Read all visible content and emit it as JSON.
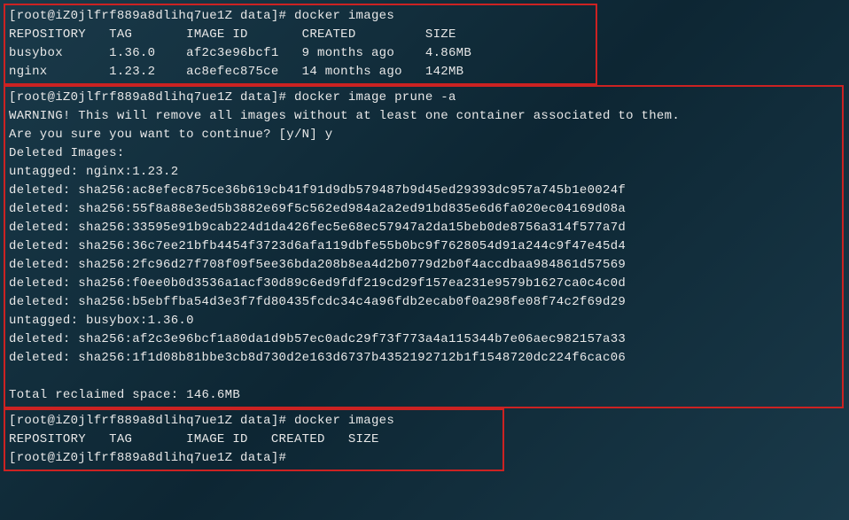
{
  "section1": {
    "prompt": "[root@iZ0jlfrf889a8dlihq7ue1Z data]# docker images",
    "header": "REPOSITORY   TAG       IMAGE ID       CREATED         SIZE",
    "row1": "busybox      1.36.0    af2c3e96bcf1   9 months ago    4.86MB",
    "row2": "nginx        1.23.2    ac8efec875ce   14 months ago   142MB"
  },
  "section2": {
    "prompt": "[root@iZ0jlfrf889a8dlihq7ue1Z data]# docker image prune -a",
    "warning": "WARNING! This will remove all images without at least one container associated to them.",
    "confirm": "Are you sure you want to continue? [y/N] y",
    "deleted_header": "Deleted Images:",
    "untagged1": "untagged: nginx:1.23.2",
    "deleted1": "deleted: sha256:ac8efec875ce36b619cb41f91d9db579487b9d45ed29393dc957a745b1e0024f",
    "deleted2": "deleted: sha256:55f8a88e3ed5b3882e69f5c562ed984a2a2ed91bd835e6d6fa020ec04169d08a",
    "deleted3": "deleted: sha256:33595e91b9cab224d1da426fec5e68ec57947a2da15beb0de8756a314f577a7d",
    "deleted4": "deleted: sha256:36c7ee21bfb4454f3723d6afa119dbfe55b0bc9f7628054d91a244c9f47e45d4",
    "deleted5": "deleted: sha256:2fc96d27f708f09f5ee36bda208b8ea4d2b0779d2b0f4accdbaa984861d57569",
    "deleted6": "deleted: sha256:f0ee0b0d3536a1acf30d89c6ed9fdf219cd29f157ea231e9579b1627ca0c4c0d",
    "deleted7": "deleted: sha256:b5ebffba54d3e3f7fd80435fcdc34c4a96fdb2ecab0f0a298fe08f74c2f69d29",
    "untagged2": "untagged: busybox:1.36.0",
    "deleted8": "deleted: sha256:af2c3e96bcf1a80da1d9b57ec0adc29f73f773a4a115344b7e06aec982157a33",
    "deleted9": "deleted: sha256:1f1d08b81bbe3cb8d730d2e163d6737b4352192712b1f1548720dc224f6cac06",
    "blank": " ",
    "reclaimed": "Total reclaimed space: 146.6MB"
  },
  "section3": {
    "prompt1": "[root@iZ0jlfrf889a8dlihq7ue1Z data]# docker images",
    "header": "REPOSITORY   TAG       IMAGE ID   CREATED   SIZE",
    "prompt2": "[root@iZ0jlfrf889a8dlihq7ue1Z data]#"
  }
}
